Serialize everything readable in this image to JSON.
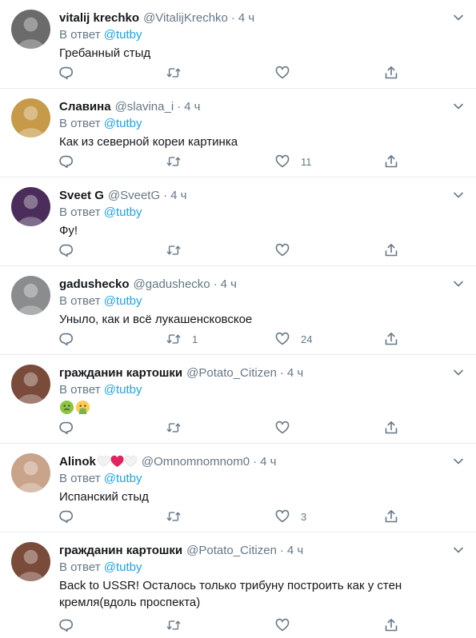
{
  "reply_prefix": "В ответ",
  "tweets": [
    {
      "name": "vitalij krechko",
      "handle": "@VitalijKrechko",
      "time": "4 ч",
      "reply_to": "@tutby",
      "text": "Гребанный стыд",
      "retweets": "",
      "likes": "",
      "avatar_color": "#6b6b6b"
    },
    {
      "name": "Славина",
      "handle": "@slavina_i",
      "time": "4 ч",
      "reply_to": "@tutby",
      "text": "Как из северной кореи картинка",
      "retweets": "",
      "likes": "11",
      "avatar_color": "#c79a4a"
    },
    {
      "name": "Sveet G",
      "handle": "@SveetG",
      "time": "4 ч",
      "reply_to": "@tutby",
      "text": "Фу!",
      "retweets": "",
      "likes": "",
      "avatar_color": "#4a2d5a"
    },
    {
      "name": "gadushecko",
      "handle": "@gadushecko",
      "time": "4 ч",
      "reply_to": "@tutby",
      "text": "Уныло, как и всё лукашенсковское",
      "retweets": "1",
      "likes": "24",
      "avatar_color": "#8a8c8e"
    },
    {
      "name": "гражданин картошки",
      "handle": "@Potato_Citizen",
      "time": "4 ч",
      "reply_to": "@tutby",
      "text": "",
      "emojis": [
        "nauseated-face-emoji",
        "vomiting-face-emoji"
      ],
      "retweets": "",
      "likes": "",
      "avatar_color": "#7a4a3a"
    },
    {
      "name": "Alinok",
      "name_hearts": [
        "white-heart-icon",
        "red-heart-icon",
        "white-heart-icon"
      ],
      "handle": "@Omnomnomnom0",
      "time": "4 ч",
      "reply_to": "@tutby",
      "text": "Испанский стыд",
      "retweets": "",
      "likes": "3",
      "avatar_color": "#c9a48a"
    },
    {
      "name": "гражданин картошки",
      "handle": "@Potato_Citizen",
      "time": "4 ч",
      "reply_to": "@tutby",
      "text": "Back to USSR! Осталось только трибуну построить как у стен кремля(вдоль проспекта)",
      "retweets": "",
      "likes": "",
      "avatar_color": "#7a4a3a"
    }
  ],
  "colors": {
    "link": "#1da1f2",
    "secondary": "#657786",
    "primary_text": "#14171a",
    "divider": "#e6ecf0"
  }
}
